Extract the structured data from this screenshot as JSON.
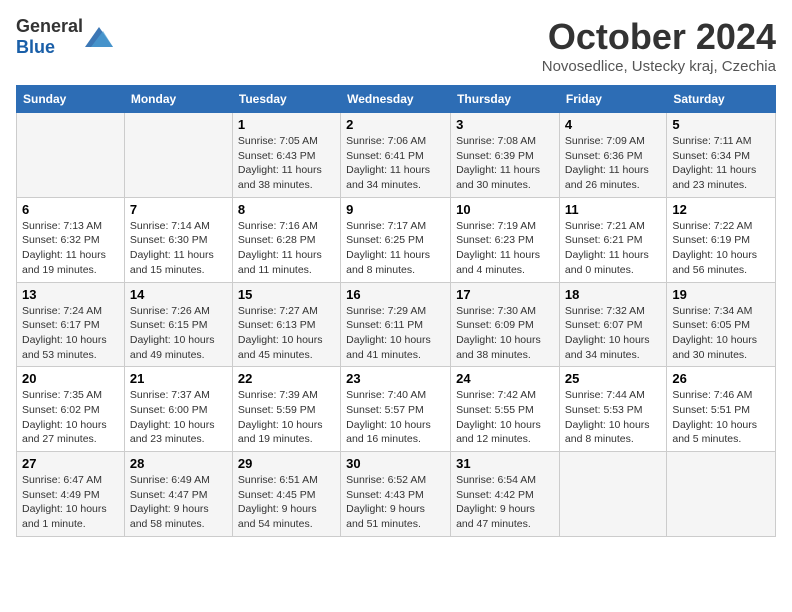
{
  "header": {
    "logo_general": "General",
    "logo_blue": "Blue",
    "month_title": "October 2024",
    "location": "Novosedlice, Ustecky kraj, Czechia"
  },
  "weekdays": [
    "Sunday",
    "Monday",
    "Tuesday",
    "Wednesday",
    "Thursday",
    "Friday",
    "Saturday"
  ],
  "weeks": [
    [
      {
        "day": "",
        "info": ""
      },
      {
        "day": "",
        "info": ""
      },
      {
        "day": "1",
        "info": "Sunrise: 7:05 AM\nSunset: 6:43 PM\nDaylight: 11 hours and 38 minutes."
      },
      {
        "day": "2",
        "info": "Sunrise: 7:06 AM\nSunset: 6:41 PM\nDaylight: 11 hours and 34 minutes."
      },
      {
        "day": "3",
        "info": "Sunrise: 7:08 AM\nSunset: 6:39 PM\nDaylight: 11 hours and 30 minutes."
      },
      {
        "day": "4",
        "info": "Sunrise: 7:09 AM\nSunset: 6:36 PM\nDaylight: 11 hours and 26 minutes."
      },
      {
        "day": "5",
        "info": "Sunrise: 7:11 AM\nSunset: 6:34 PM\nDaylight: 11 hours and 23 minutes."
      }
    ],
    [
      {
        "day": "6",
        "info": "Sunrise: 7:13 AM\nSunset: 6:32 PM\nDaylight: 11 hours and 19 minutes."
      },
      {
        "day": "7",
        "info": "Sunrise: 7:14 AM\nSunset: 6:30 PM\nDaylight: 11 hours and 15 minutes."
      },
      {
        "day": "8",
        "info": "Sunrise: 7:16 AM\nSunset: 6:28 PM\nDaylight: 11 hours and 11 minutes."
      },
      {
        "day": "9",
        "info": "Sunrise: 7:17 AM\nSunset: 6:25 PM\nDaylight: 11 hours and 8 minutes."
      },
      {
        "day": "10",
        "info": "Sunrise: 7:19 AM\nSunset: 6:23 PM\nDaylight: 11 hours and 4 minutes."
      },
      {
        "day": "11",
        "info": "Sunrise: 7:21 AM\nSunset: 6:21 PM\nDaylight: 11 hours and 0 minutes."
      },
      {
        "day": "12",
        "info": "Sunrise: 7:22 AM\nSunset: 6:19 PM\nDaylight: 10 hours and 56 minutes."
      }
    ],
    [
      {
        "day": "13",
        "info": "Sunrise: 7:24 AM\nSunset: 6:17 PM\nDaylight: 10 hours and 53 minutes."
      },
      {
        "day": "14",
        "info": "Sunrise: 7:26 AM\nSunset: 6:15 PM\nDaylight: 10 hours and 49 minutes."
      },
      {
        "day": "15",
        "info": "Sunrise: 7:27 AM\nSunset: 6:13 PM\nDaylight: 10 hours and 45 minutes."
      },
      {
        "day": "16",
        "info": "Sunrise: 7:29 AM\nSunset: 6:11 PM\nDaylight: 10 hours and 41 minutes."
      },
      {
        "day": "17",
        "info": "Sunrise: 7:30 AM\nSunset: 6:09 PM\nDaylight: 10 hours and 38 minutes."
      },
      {
        "day": "18",
        "info": "Sunrise: 7:32 AM\nSunset: 6:07 PM\nDaylight: 10 hours and 34 minutes."
      },
      {
        "day": "19",
        "info": "Sunrise: 7:34 AM\nSunset: 6:05 PM\nDaylight: 10 hours and 30 minutes."
      }
    ],
    [
      {
        "day": "20",
        "info": "Sunrise: 7:35 AM\nSunset: 6:02 PM\nDaylight: 10 hours and 27 minutes."
      },
      {
        "day": "21",
        "info": "Sunrise: 7:37 AM\nSunset: 6:00 PM\nDaylight: 10 hours and 23 minutes."
      },
      {
        "day": "22",
        "info": "Sunrise: 7:39 AM\nSunset: 5:59 PM\nDaylight: 10 hours and 19 minutes."
      },
      {
        "day": "23",
        "info": "Sunrise: 7:40 AM\nSunset: 5:57 PM\nDaylight: 10 hours and 16 minutes."
      },
      {
        "day": "24",
        "info": "Sunrise: 7:42 AM\nSunset: 5:55 PM\nDaylight: 10 hours and 12 minutes."
      },
      {
        "day": "25",
        "info": "Sunrise: 7:44 AM\nSunset: 5:53 PM\nDaylight: 10 hours and 8 minutes."
      },
      {
        "day": "26",
        "info": "Sunrise: 7:46 AM\nSunset: 5:51 PM\nDaylight: 10 hours and 5 minutes."
      }
    ],
    [
      {
        "day": "27",
        "info": "Sunrise: 6:47 AM\nSunset: 4:49 PM\nDaylight: 10 hours and 1 minute."
      },
      {
        "day": "28",
        "info": "Sunrise: 6:49 AM\nSunset: 4:47 PM\nDaylight: 9 hours and 58 minutes."
      },
      {
        "day": "29",
        "info": "Sunrise: 6:51 AM\nSunset: 4:45 PM\nDaylight: 9 hours and 54 minutes."
      },
      {
        "day": "30",
        "info": "Sunrise: 6:52 AM\nSunset: 4:43 PM\nDaylight: 9 hours and 51 minutes."
      },
      {
        "day": "31",
        "info": "Sunrise: 6:54 AM\nSunset: 4:42 PM\nDaylight: 9 hours and 47 minutes."
      },
      {
        "day": "",
        "info": ""
      },
      {
        "day": "",
        "info": ""
      }
    ]
  ]
}
